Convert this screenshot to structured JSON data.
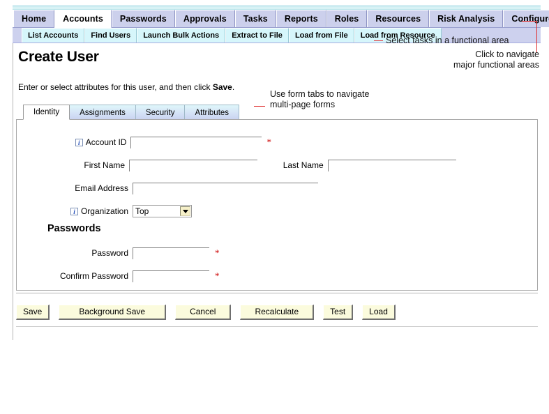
{
  "app": {
    "main_tabs": [
      {
        "label": "Home",
        "active": false
      },
      {
        "label": "Accounts",
        "active": true
      },
      {
        "label": "Passwords",
        "active": false
      },
      {
        "label": "Approvals",
        "active": false
      },
      {
        "label": "Tasks",
        "active": false
      },
      {
        "label": "Reports",
        "active": false
      },
      {
        "label": "Roles",
        "active": false
      },
      {
        "label": "Resources",
        "active": false
      },
      {
        "label": "Risk Analysis",
        "active": false
      },
      {
        "label": "Configure",
        "active": false
      }
    ],
    "sub_tabs": [
      {
        "label": "List Accounts"
      },
      {
        "label": "Find Users"
      },
      {
        "label": "Launch Bulk Actions"
      },
      {
        "label": "Extract to File"
      },
      {
        "label": "Load from File"
      },
      {
        "label": "Load from Resource"
      }
    ]
  },
  "page": {
    "title": "Create User",
    "instructions_before": "Enter or select attributes for this user, and then click ",
    "instructions_bold": "Save",
    "instructions_after": "."
  },
  "form": {
    "tabs": [
      {
        "label": "Identity",
        "active": true
      },
      {
        "label": "Assignments",
        "active": false
      },
      {
        "label": "Security",
        "active": false
      },
      {
        "label": "Attributes",
        "active": false
      }
    ],
    "fields": {
      "account_id": {
        "label": "Account ID",
        "value": "",
        "required_marker": "*",
        "has_info": true
      },
      "first_name": {
        "label": "First Name",
        "value": "",
        "has_info": false
      },
      "last_name": {
        "label": "Last Name",
        "value": "",
        "has_info": false
      },
      "email_address": {
        "label": "Email Address",
        "value": "",
        "has_info": false
      },
      "organization": {
        "label": "Organization",
        "value": "Top",
        "has_info": true,
        "options": [
          "Top"
        ]
      }
    },
    "passwords_section": {
      "heading": "Passwords",
      "password": {
        "label": "Password",
        "value": "",
        "required_marker": "*"
      },
      "confirm_password": {
        "label": "Confirm Password",
        "value": "",
        "required_marker": "*"
      }
    },
    "info_icon_glyph": "i"
  },
  "buttons": [
    {
      "label": "Save",
      "size": "small"
    },
    {
      "label": "Background Save",
      "size": "wide"
    },
    {
      "label": "Cancel",
      "size": "med"
    },
    {
      "label": "Recalculate",
      "size": "med"
    },
    {
      "label": "Test",
      "size": "small"
    },
    {
      "label": "Load",
      "size": "small"
    }
  ],
  "annotations": {
    "functional_area": "Select tasks in a functional area",
    "navigate_major_line1": "Click to navigate",
    "navigate_major_line2": "major functional areas",
    "form_tabs_line1": "Use form tabs to navigate",
    "form_tabs_line2": "multi-page forms"
  },
  "colors": {
    "callout_red": "#e03030",
    "tab_inactive": "#ccd0ec",
    "subtab": "#d6f6fb",
    "button_face": "#fbfbdd",
    "required_red": "#cc0000",
    "info_blue": "#1b48b8"
  }
}
